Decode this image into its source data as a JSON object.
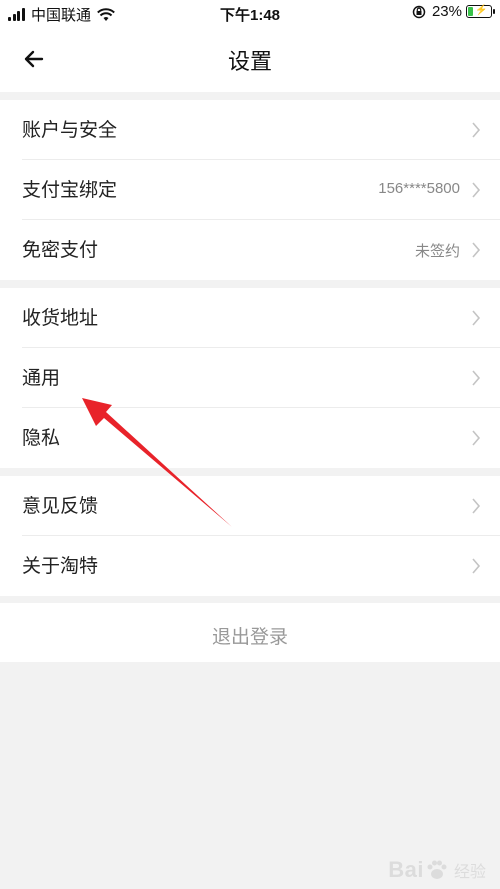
{
  "status_bar": {
    "carrier": "中国联通",
    "time": "下午1:48",
    "battery_percent": "23%",
    "battery_level": 0.23
  },
  "nav": {
    "title": "设置",
    "back_icon": "arrow-left-icon"
  },
  "groups": [
    {
      "items": [
        {
          "label": "账户与安全",
          "value": ""
        },
        {
          "label": "支付宝绑定",
          "value": "156****5800"
        },
        {
          "label": "免密支付",
          "value": "未签约"
        }
      ]
    },
    {
      "items": [
        {
          "label": "收货地址",
          "value": ""
        },
        {
          "label": "通用",
          "value": ""
        },
        {
          "label": "隐私",
          "value": ""
        }
      ]
    },
    {
      "items": [
        {
          "label": "意见反馈",
          "value": ""
        },
        {
          "label": "关于淘特",
          "value": ""
        }
      ]
    }
  ],
  "logout_label": "退出登录",
  "annotation": {
    "color": "#e8232a"
  },
  "watermark": {
    "text": "Bai",
    "sub": "经验"
  }
}
